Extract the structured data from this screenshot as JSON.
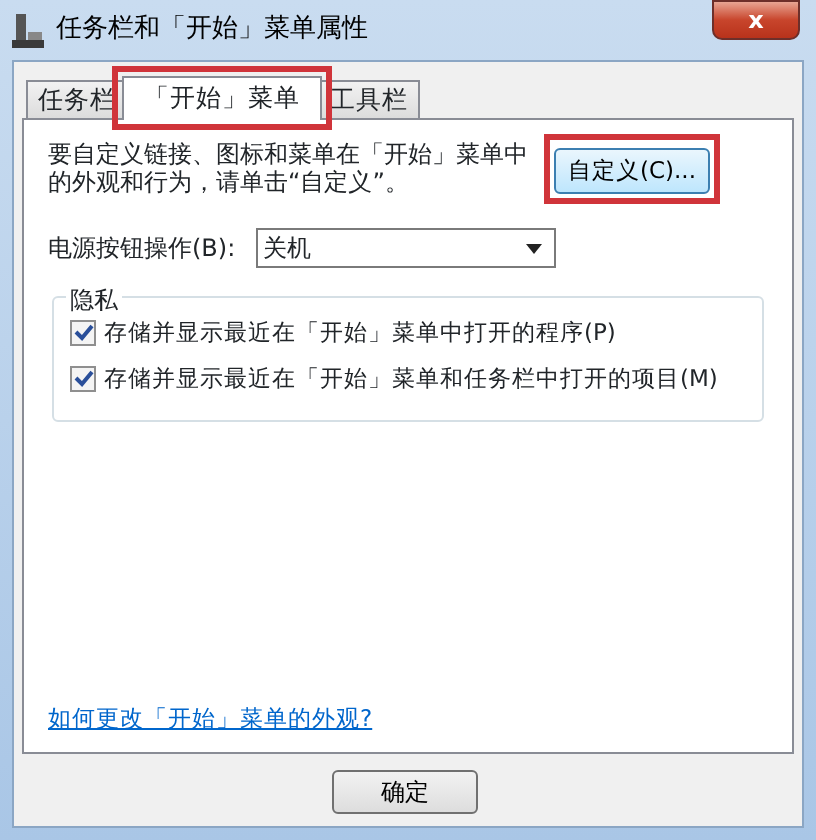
{
  "window": {
    "title": "任务栏和「开始」菜单属性",
    "close": "x"
  },
  "tabs": [
    {
      "label": "任务栏",
      "selected": false,
      "highlighted": false
    },
    {
      "label": "「开始」菜单",
      "selected": true,
      "highlighted": true
    },
    {
      "label": "工具栏",
      "selected": false,
      "highlighted": false
    }
  ],
  "intro": {
    "text": "要自定义链接、图标和菜单在「开始」菜单中的外观和行为，请单击“自定义”。",
    "button": "自定义(C)...",
    "highlighted": true
  },
  "power": {
    "label": "电源按钮操作(B):",
    "value": "关机"
  },
  "privacy": {
    "title": "隐私",
    "options": [
      {
        "label": "存储并显示最近在「开始」菜单中打开的程序(P)",
        "checked": true
      },
      {
        "label": "存储并显示最近在「开始」菜单和任务栏中打开的项目(M)",
        "checked": true
      }
    ]
  },
  "help_link": "如何更改「开始」菜单的外观?",
  "buttons": [
    "确定"
  ]
}
